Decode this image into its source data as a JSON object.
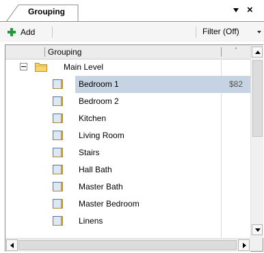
{
  "tab": {
    "label": "Grouping"
  },
  "window_controls": {
    "pin_icon": "pin-dropdown-icon",
    "close_label": "×"
  },
  "toolbar": {
    "add_label": "Add",
    "filter_label": "Filter (Off)"
  },
  "grid": {
    "columns": [
      "Grouping",
      "'"
    ],
    "tree": {
      "root": {
        "label": "Main Level",
        "expanded": true,
        "icon": "folder-icon"
      },
      "items": [
        {
          "label": "Bedroom 1",
          "value": "$82",
          "selected": true
        },
        {
          "label": "Bedroom 2",
          "value": ""
        },
        {
          "label": "Kitchen",
          "value": ""
        },
        {
          "label": "Living Room",
          "value": ""
        },
        {
          "label": "Stairs",
          "value": ""
        },
        {
          "label": "Hall Bath",
          "value": ""
        },
        {
          "label": "Master Bath",
          "value": ""
        },
        {
          "label": "Master Bedroom",
          "value": ""
        },
        {
          "label": "Linens",
          "value": ""
        }
      ]
    }
  },
  "colors": {
    "selection": "#c5d3e2",
    "add_plus": "#1e9b3a",
    "folder": "#f5c842"
  }
}
